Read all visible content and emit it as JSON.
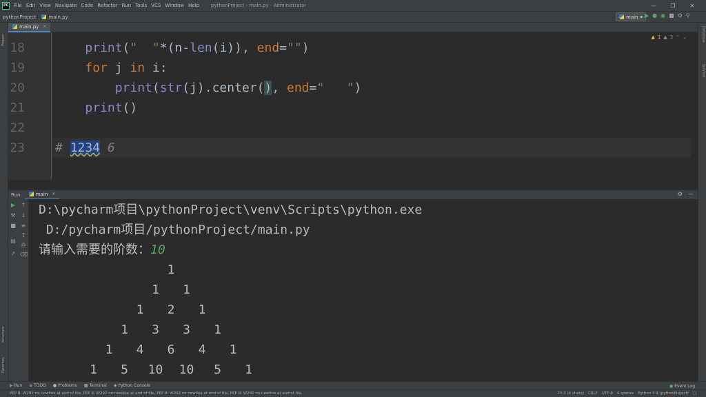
{
  "menubar": {
    "items": [
      "File",
      "Edit",
      "View",
      "Navigate",
      "Code",
      "Refactor",
      "Run",
      "Tools",
      "VCS",
      "Window",
      "Help"
    ],
    "window_title": "pythonProject - main.py - Administrator"
  },
  "navbar": {
    "project": "pythonProject",
    "file": "main.py",
    "run_config": "main"
  },
  "side_labels": {
    "left_top": "Project",
    "left_structure": "Structure",
    "left_favorites": "Favorites",
    "right_database": "Database",
    "right_sciview": "SciView"
  },
  "editor": {
    "tab": "main.py",
    "inspections": {
      "warnings": "1",
      "weak_warnings": "3"
    },
    "lines": [
      {
        "num": "18",
        "text": "    print(\"  \"*(n-len(i)), end=\"\")"
      },
      {
        "num": "19",
        "text": "    for j in i:"
      },
      {
        "num": "20",
        "text": "        print(str(j).center(), end=\"   \")"
      },
      {
        "num": "21",
        "text": "    print()"
      },
      {
        "num": "22",
        "text": ""
      },
      {
        "num": "23",
        "text": "# 1234 6"
      }
    ],
    "comment_prefix": "# ",
    "comment_selected": "1234",
    "comment_suffix": " 6"
  },
  "run": {
    "label": "Run:",
    "tab": "main",
    "console": {
      "cmd1": "D:\\pycharm项目\\pythonProject\\venv\\Scripts\\python.exe",
      "cmd2": " D:/pycharm项目/pythonProject/main.py",
      "prompt": "请输入需要的阶数：",
      "user_input": "10",
      "triangle": [
        [
          "1"
        ],
        [
          "1",
          "1"
        ],
        [
          "1",
          "2",
          "1"
        ],
        [
          "1",
          "3",
          "3",
          "1"
        ],
        [
          "1",
          "4",
          "6",
          "4",
          "1"
        ],
        [
          "1",
          "5",
          "10",
          "10",
          "5",
          "1"
        ]
      ]
    }
  },
  "toolbar": {
    "run": "Run",
    "todo": "TODO",
    "problems": "Problems",
    "terminal": "Terminal",
    "python_console": "Python Console",
    "event_log": "Event Log"
  },
  "status": {
    "message": "PEP 8: W292 no newline at end of file, PEP 8: W292 no newline at end of file, PEP 8: W292 no newline at end of file, PEP 8: W292 no newline at end of file.",
    "position": "23:3 (4 chars)",
    "line_sep": "CRLF",
    "encoding": "UTF-8",
    "indent": "4 spaces",
    "interpreter": "Python 3.9 (pythonProject)"
  }
}
